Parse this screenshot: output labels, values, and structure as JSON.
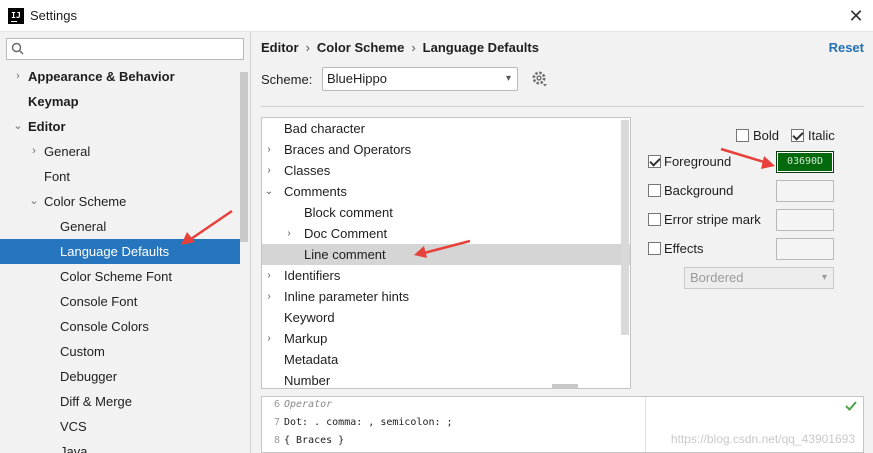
{
  "window": {
    "title": "Settings",
    "app_icon": "IJ",
    "close_icon": "close-icon"
  },
  "sidebar": {
    "search_placeholder": "",
    "items": [
      {
        "label": "Appearance & Behavior",
        "arrow": "›",
        "indent": 0,
        "bold": true
      },
      {
        "label": "Keymap",
        "arrow": "",
        "indent": 0,
        "bold": true
      },
      {
        "label": "Editor",
        "arrow": "⌄",
        "indent": 0,
        "bold": true
      },
      {
        "label": "General",
        "arrow": "›",
        "indent": 1,
        "bold": false
      },
      {
        "label": "Font",
        "arrow": "",
        "indent": 1,
        "bold": false
      },
      {
        "label": "Color Scheme",
        "arrow": "⌄",
        "indent": 1,
        "bold": false
      },
      {
        "label": "General",
        "arrow": "",
        "indent": 2,
        "bold": false
      },
      {
        "label": "Language Defaults",
        "arrow": "",
        "indent": 2,
        "bold": false,
        "selected": true
      },
      {
        "label": "Color Scheme Font",
        "arrow": "",
        "indent": 2,
        "bold": false
      },
      {
        "label": "Console Font",
        "arrow": "",
        "indent": 2,
        "bold": false
      },
      {
        "label": "Console Colors",
        "arrow": "",
        "indent": 2,
        "bold": false
      },
      {
        "label": "Custom",
        "arrow": "",
        "indent": 2,
        "bold": false
      },
      {
        "label": "Debugger",
        "arrow": "",
        "indent": 2,
        "bold": false
      },
      {
        "label": "Diff & Merge",
        "arrow": "",
        "indent": 2,
        "bold": false
      },
      {
        "label": "VCS",
        "arrow": "",
        "indent": 2,
        "bold": false
      },
      {
        "label": "Java",
        "arrow": "",
        "indent": 2,
        "bold": false
      }
    ]
  },
  "header": {
    "breadcrumb": [
      "Editor",
      "Color Scheme",
      "Language Defaults"
    ],
    "separator": "›",
    "reset_label": "Reset"
  },
  "scheme": {
    "label": "Scheme:",
    "value": "BlueHippo"
  },
  "options": [
    {
      "label": "Bad character",
      "arrow": "",
      "indent": 0
    },
    {
      "label": "Braces and Operators",
      "arrow": "›",
      "indent": 0
    },
    {
      "label": "Classes",
      "arrow": "›",
      "indent": 0
    },
    {
      "label": "Comments",
      "arrow": "⌄",
      "indent": 0
    },
    {
      "label": "Block comment",
      "arrow": "",
      "indent": 1
    },
    {
      "label": "Doc Comment",
      "arrow": "›",
      "indent": 1
    },
    {
      "label": "Line comment",
      "arrow": "",
      "indent": 1,
      "selected": true
    },
    {
      "label": "Identifiers",
      "arrow": "›",
      "indent": 0
    },
    {
      "label": "Inline parameter hints",
      "arrow": "›",
      "indent": 0
    },
    {
      "label": "Keyword",
      "arrow": "",
      "indent": 0
    },
    {
      "label": "Markup",
      "arrow": "›",
      "indent": 0
    },
    {
      "label": "Metadata",
      "arrow": "",
      "indent": 0
    },
    {
      "label": "Number",
      "arrow": "",
      "indent": 0
    }
  ],
  "props": {
    "bold": {
      "label": "Bold",
      "checked": false
    },
    "italic": {
      "label": "Italic",
      "checked": true
    },
    "foreground": {
      "label": "Foreground",
      "checked": true,
      "value": "03690D",
      "color": "#03690D"
    },
    "background": {
      "label": "Background",
      "checked": false
    },
    "error_stripe": {
      "label": "Error stripe mark",
      "checked": false
    },
    "effects": {
      "label": "Effects",
      "checked": false,
      "select_value": "Bordered"
    }
  },
  "preview": {
    "lines": [
      {
        "num": "6",
        "text": "Operator"
      },
      {
        "num": "7",
        "text": "Dot: . comma: , semicolon: ;"
      },
      {
        "num": "8",
        "text": "{ Braces }"
      }
    ],
    "watermark": "https://blog.csdn.net/qq_43901693"
  },
  "colors": {
    "selection": "#2675bf",
    "accent": "#2470b3",
    "annotation": "#e8413b"
  }
}
